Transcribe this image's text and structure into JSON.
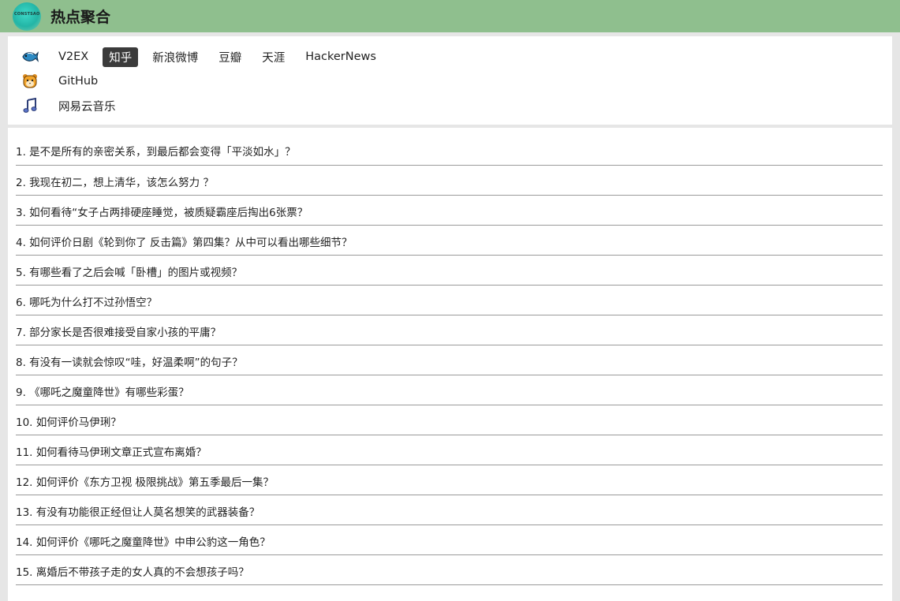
{
  "header": {
    "logo_text": "CONSTSAO",
    "title": "热点聚合"
  },
  "nav": {
    "rows": [
      {
        "icon": "fish-icon",
        "items": [
          {
            "label": "V2EX",
            "active": false
          },
          {
            "label": "知乎",
            "active": true
          },
          {
            "label": "新浪微博",
            "active": false
          },
          {
            "label": "豆瓣",
            "active": false
          },
          {
            "label": "天涯",
            "active": false
          },
          {
            "label": "HackerNews",
            "active": false
          }
        ]
      },
      {
        "icon": "tiger-icon",
        "items": [
          {
            "label": "GitHub",
            "active": false
          }
        ]
      },
      {
        "icon": "music-note-icon",
        "items": [
          {
            "label": "网易云音乐",
            "active": false
          }
        ]
      }
    ]
  },
  "list": {
    "items": [
      "1. 是不是所有的亲密关系，到最后都会变得「平淡如水」？",
      "2. 我现在初二，想上清华，该怎么努力 ？",
      "3. 如何看待“女子占两排硬座睡觉，被质疑霸座后掏出6张票？",
      "4. 如何评价日剧《轮到你了 反击篇》第四集？从中可以看出哪些细节？",
      "5. 有哪些看了之后会喊「卧槽」的图片或视频？",
      "6. 哪吒为什么打不过孙悟空？",
      "7. 部分家长是否很难接受自家小孩的平庸？",
      "8. 有没有一读就会惊叹“哇，好温柔啊”的句子？",
      "9. 《哪吒之魔童降世》有哪些彩蛋？",
      "10. 如何评价马伊琍？",
      "11. 如何看待马伊琍文章正式宣布离婚？",
      "12. 如何评价《东方卫视 极限挑战》第五季最后一集？",
      "13. 有没有功能很正经但让人莫名想笑的武器装备？",
      "14. 如何评价《哪吒之魔童降世》中申公豹这一角色？",
      "15. 离婚后不带孩子走的女人真的不会想孩子吗？"
    ]
  }
}
